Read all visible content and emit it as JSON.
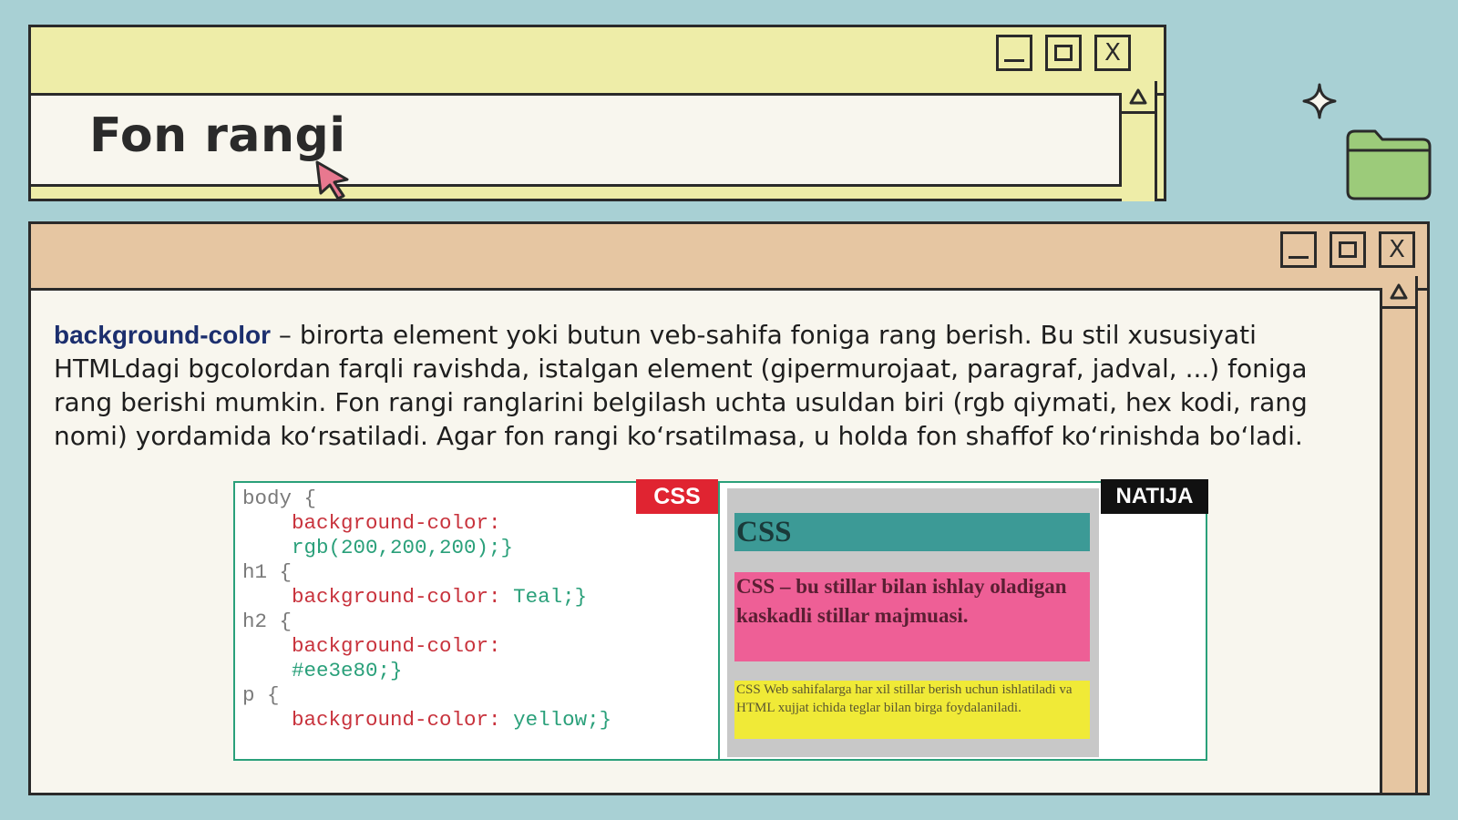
{
  "title_window": {
    "title": "Fon rangi",
    "controls": {
      "minimize": "minimize-icon",
      "maximize": "maximize-icon",
      "close": "X"
    },
    "scroll_up_icon": "triangle-up-icon",
    "colors": {
      "frame": "#eeeda8",
      "content": "#f8f6ee"
    }
  },
  "content_window": {
    "controls": {
      "minimize": "minimize-icon",
      "maximize": "maximize-icon",
      "close": "X"
    },
    "scroll_up_icon": "triangle-up-icon",
    "colors": {
      "frame": "#e6c6a2",
      "content": "#f8f6ee"
    },
    "term": "background-color",
    "description": " – birorta element yoki butun veb-sahifa foniga rang berish. Bu stil xususiyati HTMLdagi bgcolordan farqli ravishda, istalgan element (gipermurojaat, paragraf, jadval, ...) foniga rang berishi mumkin. Fon rangi ranglarini belgilash uchta usuldan biri (rgb qiymati, hex kodi, rang nomi) yordamida ko‘rsatiladi. Agar fon rangi ko‘rsatilmasa, u holda fon shaffof ko‘rinishda bo‘ladi."
  },
  "figure": {
    "css_label": "CSS",
    "result_label": "NATIJA",
    "code": {
      "l1": "body {",
      "l2_prop": "background-color:",
      "l3_val": "rgb(200,200,200);}",
      "l4": "h1 {",
      "l5_prop": "background-color: ",
      "l5_val": "Teal;}",
      "l6": "h2 {",
      "l7_prop": "background-color:",
      "l8_val": "#ee3e80;}",
      "l9": "p {",
      "l10_prop": "background-color: ",
      "l10_val": "yellow;}"
    },
    "demo": {
      "h1": "CSS",
      "h2": "CSS – bu stillar bilan ishlay oladigan kaskadli stillar majmuasi.",
      "p": "CSS Web sahifalarga har xil stillar berish uchun ishlatiladi va HTML xujjat ichida teglar bilan birga foydalaniladi."
    },
    "colors": {
      "css_tag": "#e02431",
      "natija_tag": "#111111",
      "teal": "#3c9a96",
      "pink": "#ee5f96",
      "yellow": "#f0ea37",
      "body_gray": "#c8c8c8"
    }
  },
  "decorations": {
    "sparkle": "sparkle-icon",
    "folder": "folder-icon",
    "cursor": "cursor-arrow-icon"
  }
}
